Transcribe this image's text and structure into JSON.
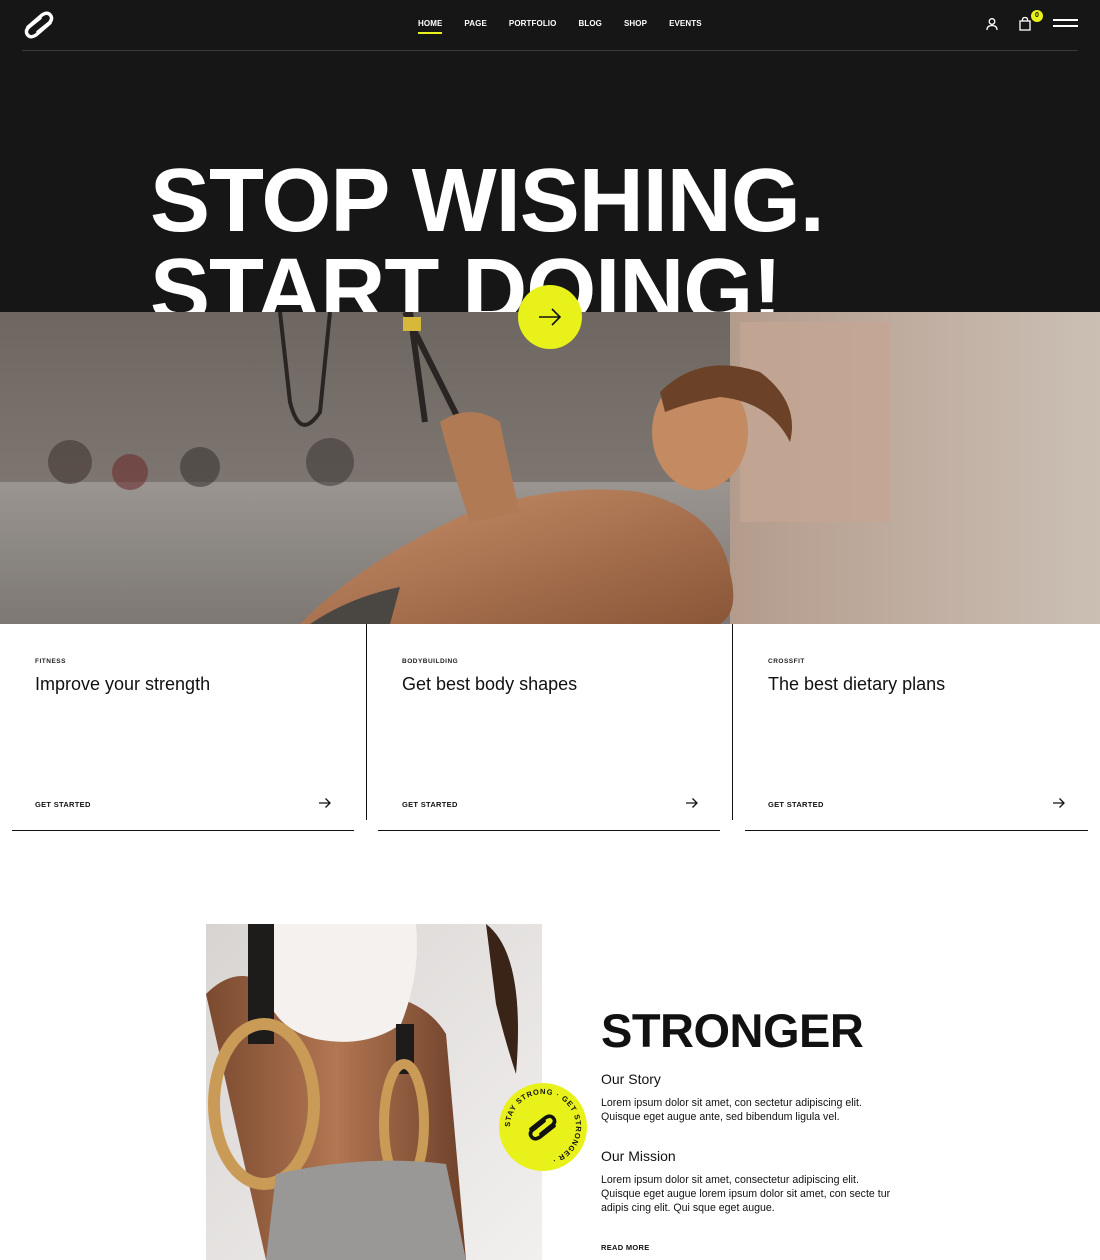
{
  "brand": {
    "accent": "#e8f21a",
    "dark": "#171616"
  },
  "header": {
    "nav": [
      {
        "label": "HOME",
        "active": true
      },
      {
        "label": "PAGE",
        "active": false
      },
      {
        "label": "PORTFOLIO",
        "active": false
      },
      {
        "label": "BLOG",
        "active": false
      },
      {
        "label": "SHOP",
        "active": false
      },
      {
        "label": "EVENTS",
        "active": false
      }
    ],
    "cart_count": "0",
    "icons": [
      "logo-icon",
      "user-icon",
      "cart-icon",
      "menu-icon"
    ]
  },
  "hero": {
    "headline": "STOP WISHING.\nSTART DOING!",
    "cta_icon": "arrow-right-icon"
  },
  "cards": [
    {
      "category": "FITNESS",
      "title": "Improve your strength",
      "cta": "GET STARTED"
    },
    {
      "category": "BODYBUILDING",
      "title": "Get best body shapes",
      "cta": "GET STARTED"
    },
    {
      "category": "CROSSFIT",
      "title": "The best dietary plans",
      "cta": "GET STARTED"
    }
  ],
  "about": {
    "title": "STRONGER",
    "badge_text": "STAY STRONG · GET STRONGER ·",
    "story_title": "Our Story",
    "story_text": "Lorem ipsum dolor sit amet, con sectetur adipiscing elit. Quisque eget augue ante, sed bibendum ligula vel.",
    "mission_title": "Our Mission",
    "mission_text": "Lorem ipsum dolor sit amet, consectetur adipiscing elit. Quisque eget augue lorem ipsum dolor sit amet, con secte tur adipis cing elit. Qui sque eget augue.",
    "read_more": "READ MORE"
  }
}
